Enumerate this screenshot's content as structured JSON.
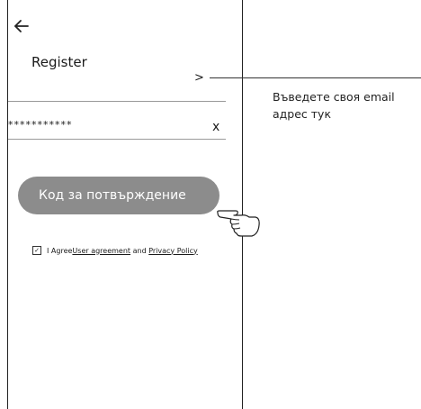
{
  "header": {
    "back_icon": "arrow-left-icon",
    "title": "Register"
  },
  "email_row": {
    "chevron": ">"
  },
  "password_field": {
    "value": "***********",
    "clear_label": "x"
  },
  "verify_button": {
    "label": "Код за потвърждение"
  },
  "agreement": {
    "checked": true,
    "check_glyph": "✓",
    "prefix": "I Agree ",
    "user_agreement": "User agreement",
    "conjunction": " and ",
    "privacy_policy": "Privacy Policy"
  },
  "annotation": {
    "text": "Въведете своя email адрес тук"
  },
  "colors": {
    "button": "#8c8c8c",
    "button_text": "#ffffff",
    "divider": "#9a9a9a"
  }
}
